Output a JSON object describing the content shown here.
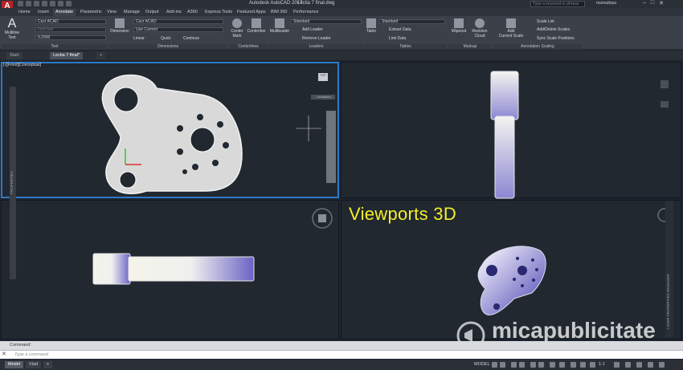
{
  "app": {
    "logo": "A",
    "title": "Autodesk AutoCAD 2017",
    "file": "Lectia 7 final.dwg",
    "search_placeholder": "Type a keyword or phrase",
    "user": "mamadopa",
    "window_controls": [
      "–",
      "□",
      "✕"
    ]
  },
  "menu_tabs": [
    {
      "label": "Home",
      "active": false
    },
    {
      "label": "Insert",
      "active": false
    },
    {
      "label": "Annotate",
      "active": true
    },
    {
      "label": "Parametric",
      "active": false
    },
    {
      "label": "View",
      "active": false
    },
    {
      "label": "Manage",
      "active": false
    },
    {
      "label": "Output",
      "active": false
    },
    {
      "label": "Add-ins",
      "active": false
    },
    {
      "label": "A360",
      "active": false
    },
    {
      "label": "Express Tools",
      "active": false
    },
    {
      "label": "Featured Apps",
      "active": false
    },
    {
      "label": "BIM 360",
      "active": false
    },
    {
      "label": "Performance",
      "active": false
    }
  ],
  "ribbon": {
    "text": {
      "multiline": "Multiline",
      "multiline2": "Text",
      "style": "Cucr ACAD",
      "find": "Find text",
      "height": "0.2000",
      "panel": "Text"
    },
    "dimensions": {
      "button": "Dimension",
      "style": "Cucr ACAD",
      "layer": "Use Current",
      "linear": "Linear",
      "quick": "Quick",
      "continue": "Continue",
      "panel": "Dimensions"
    },
    "centerlines": {
      "center_mark": "Center",
      "center_mark2": "Mark",
      "centerline": "Centerline",
      "panel": "Centerlines"
    },
    "leaders": {
      "multileader": "Multileader",
      "style": "Standard",
      "add": "Add Leader",
      "remove": "Remove Leader",
      "panel": "Leaders"
    },
    "tables": {
      "button": "Table",
      "style": "Standard",
      "extract": "Extract Data",
      "link": "Link Data",
      "panel": "Tables"
    },
    "markup": {
      "wipeout": "Wipeout",
      "revision": "Revision",
      "revision2": "Cloud",
      "panel": "Markup"
    },
    "scaling": {
      "add_current": "Add",
      "add_current2": "Current Scale",
      "scale_list": "Scale List",
      "add_delete": "Add/Delete Scales",
      "sync": "Sync Scale Positions",
      "panel": "Annotation Scaling"
    }
  },
  "doc_tabs": [
    {
      "label": "Start",
      "active": false
    },
    {
      "label": "Lectia 7 final*",
      "active": true
    },
    {
      "label": "+",
      "active": false
    }
  ],
  "viewport_label": "[-][Front][Conceptual]",
  "overlay_title": "Viewports 3D",
  "viewcube": {
    "top": "TOP",
    "wcs": "Unnamed"
  },
  "palettes": {
    "left": "PROPERTIES",
    "right": "LAYER PROPERTIES MANAGER"
  },
  "command": {
    "history": "Command:",
    "placeholder": "Type a command",
    "close": "✕"
  },
  "status_tabs": [
    {
      "label": "Model",
      "active": true
    },
    {
      "label": "Vlad",
      "active": false
    },
    {
      "label": "+",
      "active": false
    }
  ],
  "status": {
    "model": "MODEL",
    "scale": "1:1"
  },
  "watermark": "micapublicitate",
  "colors": {
    "accent": "#2f78c4",
    "overlay": "#f4ef2a",
    "logo": "#b3242a"
  }
}
